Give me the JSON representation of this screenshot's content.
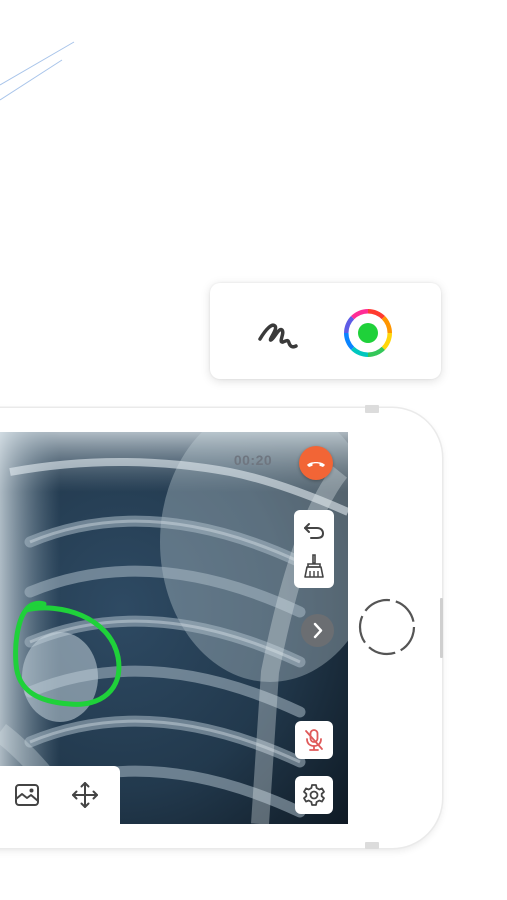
{
  "call": {
    "timer": "00:20"
  },
  "drawing_toolbar": {
    "tools": [
      {
        "name": "pen",
        "icon": "pen-squiggle-icon"
      },
      {
        "name": "color",
        "icon": "color-wheel-icon",
        "selected_color": "#1fd13a"
      }
    ]
  },
  "side_controls": {
    "icons": [
      "undo-icon",
      "clear-broom-icon",
      "chevron-right-icon",
      "mic-muted-icon",
      "settings-gear-icon"
    ]
  },
  "bottom_toolbar": {
    "icons": [
      "image-icon",
      "move-arrows-icon"
    ]
  },
  "colors": {
    "hangup": "#f26536",
    "annotation": "#1fd13a",
    "mic_muted": "#e05a5a",
    "icon_dark": "#444444"
  }
}
